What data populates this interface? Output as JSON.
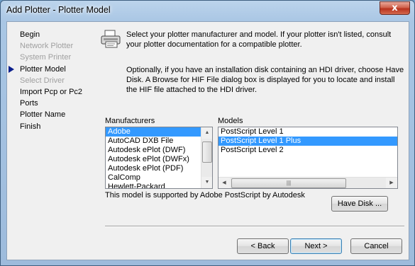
{
  "window": {
    "title": "Add Plotter - Plotter Model",
    "close_glyph": "x"
  },
  "steps": [
    {
      "label": "Begin",
      "state": "normal"
    },
    {
      "label": "Network Plotter",
      "state": "disabled"
    },
    {
      "label": "System Printer",
      "state": "disabled"
    },
    {
      "label": "Plotter Model",
      "state": "current"
    },
    {
      "label": "Select Driver",
      "state": "disabled"
    },
    {
      "label": "Import Pcp or Pc2",
      "state": "normal"
    },
    {
      "label": "Ports",
      "state": "normal"
    },
    {
      "label": "Plotter Name",
      "state": "normal"
    },
    {
      "label": "Finish",
      "state": "normal"
    }
  ],
  "icons": {
    "plotter": "plotter-icon",
    "current_step": "arrow-right-icon"
  },
  "main": {
    "intro": "Select your plotter manufacturer and model. If your plotter isn't listed, consult your plotter documentation for a compatible plotter.",
    "hdi_note": "Optionally, if you have an installation disk containing an HDI driver, choose Have Disk. A Browse for HIF File dialog box is displayed for you to locate and install the HIF file attached to the HDI driver."
  },
  "manufacturers": {
    "label": "Manufacturers",
    "items": [
      "Adobe",
      "AutoCAD DXB File",
      "Autodesk ePlot (DWF)",
      "Autodesk ePlot (DWFx)",
      "Autodesk ePlot (PDF)",
      "CalComp",
      "Hewlett-Packard"
    ],
    "selected": "Adobe"
  },
  "models": {
    "label": "Models",
    "items": [
      "PostScript Level 1",
      "PostScript Level 1 Plus",
      "PostScript Level 2"
    ],
    "selected": "PostScript Level 1 Plus"
  },
  "support_text": "This model is supported by Adobe PostScript by Autodesk",
  "buttons": {
    "have_disk": "Have Disk ...",
    "back": "< Back",
    "next": "Next >",
    "cancel": "Cancel"
  },
  "colors": {
    "selection": "#3399ff",
    "current_arrow": "#0b1f8c"
  }
}
